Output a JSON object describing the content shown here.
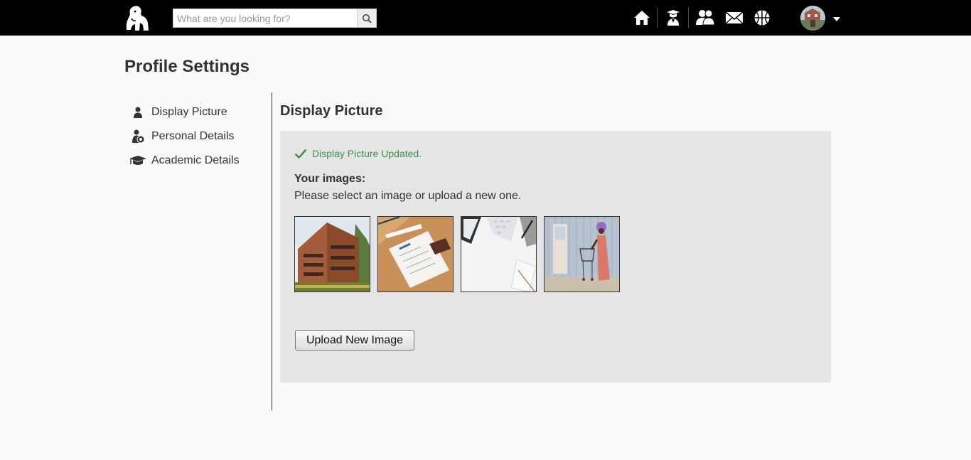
{
  "header": {
    "logo_icon": "gorilla-logo-icon",
    "search": {
      "placeholder": "What are you looking for?",
      "value": "",
      "button_icon": "search-icon"
    },
    "nav_icons": [
      "home-icon",
      "graduate-icon",
      "friends-icon",
      "mail-icon",
      "basketball-icon"
    ],
    "user_menu": {
      "avatar": "user-avatar",
      "dropdown_icon": "caret-down-icon"
    }
  },
  "page": {
    "title": "Profile Settings"
  },
  "sidebar": {
    "items": [
      {
        "label": "Display Picture",
        "icon": "user-icon"
      },
      {
        "label": "Personal Details",
        "icon": "personal-details-icon"
      },
      {
        "label": "Academic Details",
        "icon": "graduation-cap-icon"
      }
    ]
  },
  "main": {
    "section_title": "Display Picture",
    "status_message": "Display Picture Updated.",
    "images_heading": "Your images:",
    "instructions": "Please select an image or upload a new one.",
    "images": [
      {
        "name": "building-photo"
      },
      {
        "name": "sketchbook-desk-photo"
      },
      {
        "name": "white-desk-keyboard-photo"
      },
      {
        "name": "woman-shopping-cart-photo"
      }
    ],
    "upload_button": "Upload New Image"
  },
  "colors": {
    "topbar": "#000000",
    "background": "#fafafa",
    "panel": "#e5e5e5",
    "success": "#3c8f4e",
    "text": "#333333"
  }
}
